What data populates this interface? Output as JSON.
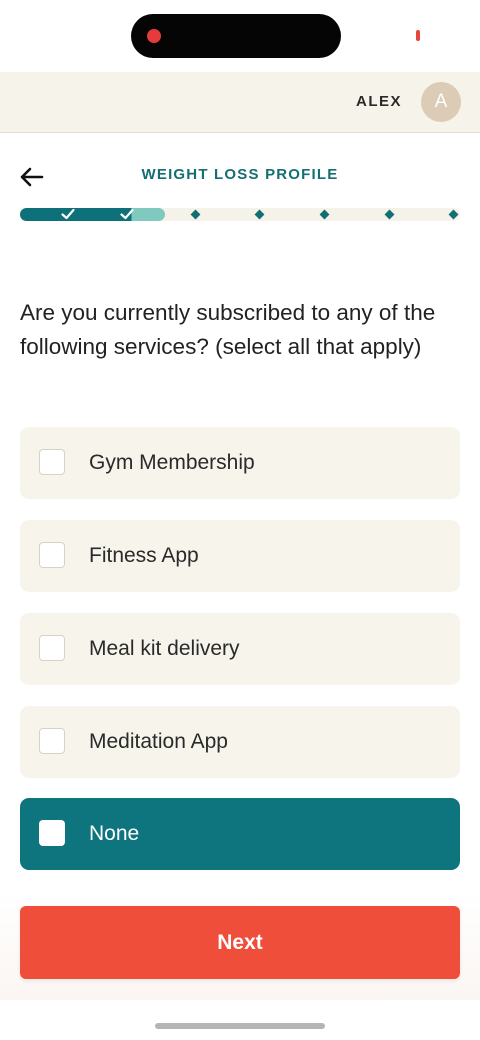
{
  "header": {
    "user_name": "ALEX",
    "avatar_initial": "A"
  },
  "page": {
    "title": "WEIGHT LOSS PROFILE",
    "question": "Are you currently subscribed to any of the following services? (select all that apply)"
  },
  "progress": {
    "completed_steps": 2,
    "total_steps": 7,
    "fill_fraction": 0.33
  },
  "options": [
    {
      "label": "Gym Membership",
      "selected": false
    },
    {
      "label": "Fitness App",
      "selected": false
    },
    {
      "label": "Meal kit delivery",
      "selected": false
    },
    {
      "label": "Meditation App",
      "selected": false
    },
    {
      "label": "None",
      "selected": true
    }
  ],
  "actions": {
    "next_label": "Next"
  },
  "colors": {
    "accent_teal": "#0e747e",
    "cta_red": "#ef4e3a",
    "card_background": "#f7f4ec"
  },
  "icons": {
    "back": "arrow-left-icon",
    "check": "checkmark-icon",
    "step": "diamond-icon"
  }
}
